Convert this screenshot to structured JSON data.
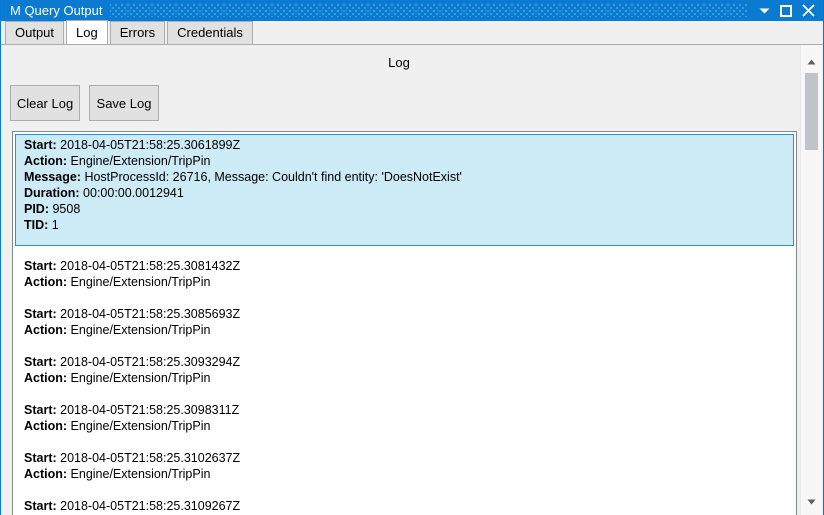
{
  "window": {
    "title": "M Query Output",
    "controls": {
      "minimize_label": "Minimize",
      "maximize_label": "Maximize",
      "close_label": "Close"
    },
    "accent_color": "#0b7ad1"
  },
  "tabs": [
    {
      "label": "Output",
      "selected": false
    },
    {
      "label": "Log",
      "selected": true
    },
    {
      "label": "Errors",
      "selected": false
    },
    {
      "label": "Credentials",
      "selected": false
    }
  ],
  "panel": {
    "heading": "Log",
    "buttons": [
      {
        "label": "Clear Log",
        "name": "clear-log-button"
      },
      {
        "label": "Save Log",
        "name": "save-log-button"
      }
    ]
  },
  "log": {
    "selection_fill": "#cdeaf7",
    "selection_border": "#1c97d8",
    "entries": [
      {
        "selected": true,
        "lines": [
          {
            "key": "Start:",
            "value": "2018-04-05T21:58:25.3061899Z"
          },
          {
            "key": "Action:",
            "value": "Engine/Extension/TripPin"
          },
          {
            "key": "Message:",
            "value": "HostProcessId: 26716, Message: Couldn't find entity: 'DoesNotExist'"
          },
          {
            "key": "Duration:",
            "value": "00:00:00.0012941"
          },
          {
            "key": "PID:",
            "value": "9508"
          },
          {
            "key": "TID:",
            "value": "1"
          }
        ]
      },
      {
        "selected": false,
        "lines": [
          {
            "key": "Start:",
            "value": "2018-04-05T21:58:25.3081432Z"
          },
          {
            "key": "Action:",
            "value": "Engine/Extension/TripPin"
          }
        ]
      },
      {
        "selected": false,
        "lines": [
          {
            "key": "Start:",
            "value": "2018-04-05T21:58:25.3085693Z"
          },
          {
            "key": "Action:",
            "value": "Engine/Extension/TripPin"
          }
        ]
      },
      {
        "selected": false,
        "lines": [
          {
            "key": "Start:",
            "value": "2018-04-05T21:58:25.3093294Z"
          },
          {
            "key": "Action:",
            "value": "Engine/Extension/TripPin"
          }
        ]
      },
      {
        "selected": false,
        "lines": [
          {
            "key": "Start:",
            "value": "2018-04-05T21:58:25.3098311Z"
          },
          {
            "key": "Action:",
            "value": "Engine/Extension/TripPin"
          }
        ]
      },
      {
        "selected": false,
        "lines": [
          {
            "key": "Start:",
            "value": "2018-04-05T21:58:25.3102637Z"
          },
          {
            "key": "Action:",
            "value": "Engine/Extension/TripPin"
          }
        ]
      },
      {
        "selected": false,
        "lines": [
          {
            "key": "Start:",
            "value": "2018-04-05T21:58:25.3109267Z"
          }
        ]
      }
    ]
  },
  "scrollbar": {
    "up_label": "Scroll up",
    "down_label": "Scroll down",
    "thumb_label": "Scroll thumb"
  }
}
